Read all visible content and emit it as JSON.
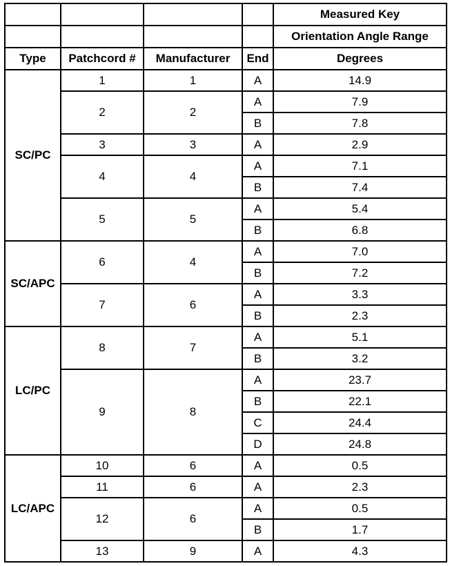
{
  "header": {
    "title_line1": "Measured Key",
    "title_line2": "Orientation Angle Range",
    "columns": {
      "type": "Type",
      "patchcord": "Patchcord #",
      "manufacturer": "Manufacturer",
      "end": "End",
      "degrees": "Degrees"
    }
  },
  "groups": [
    {
      "type": "SC/PC",
      "patchcords": [
        {
          "patchcord": "1",
          "manufacturer": "1",
          "ends": [
            {
              "end": "A",
              "degrees": "14.9"
            }
          ]
        },
        {
          "patchcord": "2",
          "manufacturer": "2",
          "ends": [
            {
              "end": "A",
              "degrees": "7.9"
            },
            {
              "end": "B",
              "degrees": "7.8"
            }
          ]
        },
        {
          "patchcord": "3",
          "manufacturer": "3",
          "ends": [
            {
              "end": "A",
              "degrees": "2.9"
            }
          ]
        },
        {
          "patchcord": "4",
          "manufacturer": "4",
          "ends": [
            {
              "end": "A",
              "degrees": "7.1"
            },
            {
              "end": "B",
              "degrees": "7.4"
            }
          ]
        },
        {
          "patchcord": "5",
          "manufacturer": "5",
          "ends": [
            {
              "end": "A",
              "degrees": "5.4"
            },
            {
              "end": "B",
              "degrees": "6.8"
            }
          ]
        }
      ]
    },
    {
      "type": "SC/APC",
      "patchcords": [
        {
          "patchcord": "6",
          "manufacturer": "4",
          "ends": [
            {
              "end": "A",
              "degrees": "7.0"
            },
            {
              "end": "B",
              "degrees": "7.2"
            }
          ]
        },
        {
          "patchcord": "7",
          "manufacturer": "6",
          "ends": [
            {
              "end": "A",
              "degrees": "3.3"
            },
            {
              "end": "B",
              "degrees": "2.3"
            }
          ]
        }
      ]
    },
    {
      "type": "LC/PC",
      "patchcords": [
        {
          "patchcord": "8",
          "manufacturer": "7",
          "ends": [
            {
              "end": "A",
              "degrees": "5.1"
            },
            {
              "end": "B",
              "degrees": "3.2"
            }
          ]
        },
        {
          "patchcord": "9",
          "manufacturer": "8",
          "ends": [
            {
              "end": "A",
              "degrees": "23.7"
            },
            {
              "end": "B",
              "degrees": "22.1"
            },
            {
              "end": "C",
              "degrees": "24.4"
            },
            {
              "end": "D",
              "degrees": "24.8"
            }
          ]
        }
      ]
    },
    {
      "type": "LC/APC",
      "patchcords": [
        {
          "patchcord": "10",
          "manufacturer": "6",
          "ends": [
            {
              "end": "A",
              "degrees": "0.5"
            }
          ]
        },
        {
          "patchcord": "11",
          "manufacturer": "6",
          "ends": [
            {
              "end": "A",
              "degrees": "2.3"
            }
          ]
        },
        {
          "patchcord": "12",
          "manufacturer": "6",
          "ends": [
            {
              "end": "A",
              "degrees": "0.5"
            },
            {
              "end": "B",
              "degrees": "1.7"
            }
          ]
        },
        {
          "patchcord": "13",
          "manufacturer": "9",
          "ends": [
            {
              "end": "A",
              "degrees": "4.3"
            }
          ]
        }
      ]
    }
  ]
}
